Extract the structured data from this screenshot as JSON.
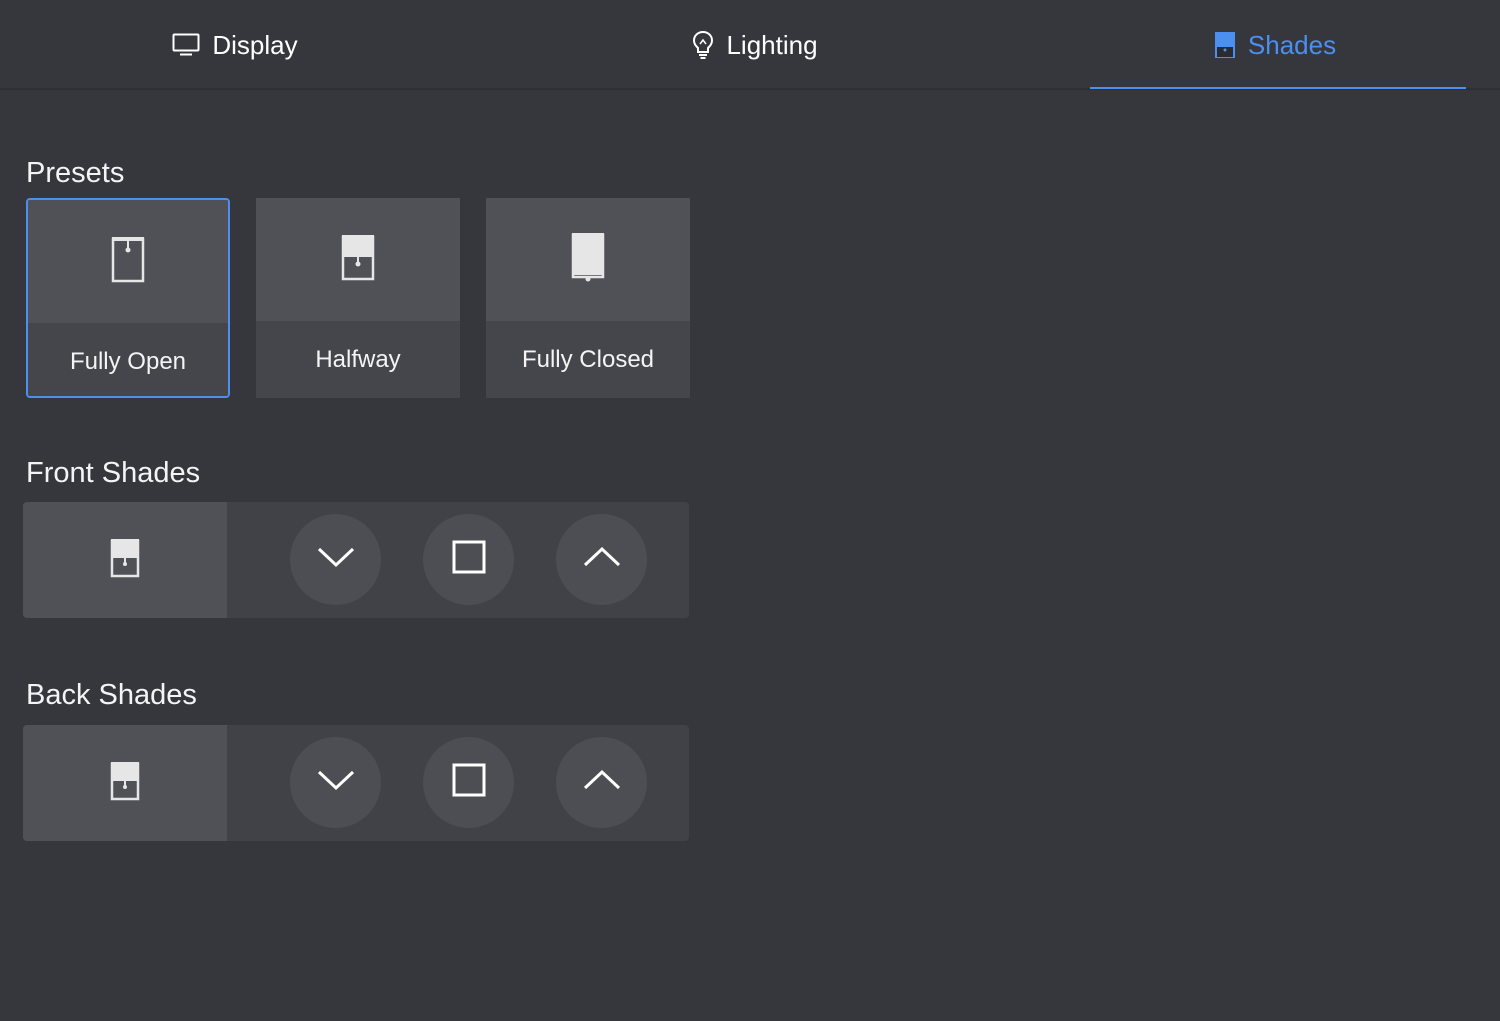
{
  "tabs": [
    {
      "label": "Display",
      "icon": "monitor-icon",
      "active": false
    },
    {
      "label": "Lighting",
      "icon": "lightbulb-icon",
      "active": false
    },
    {
      "label": "Shades",
      "icon": "shade-icon",
      "active": true
    }
  ],
  "colors": {
    "accent": "#4b8ff0",
    "background": "#36373d"
  },
  "presets": {
    "title": "Presets",
    "items": [
      {
        "label": "Fully Open",
        "icon": "shade-open-icon",
        "selected": true
      },
      {
        "label": "Halfway",
        "icon": "shade-halfway-icon",
        "selected": false
      },
      {
        "label": "Fully Closed",
        "icon": "shade-closed-icon",
        "selected": false
      }
    ]
  },
  "front_shades": {
    "title": "Front Shades",
    "status_icon": "shade-halfway-icon",
    "controls": [
      "chevron-down-icon",
      "stop-icon",
      "chevron-up-icon"
    ]
  },
  "back_shades": {
    "title": "Back Shades",
    "status_icon": "shade-halfway-icon",
    "controls": [
      "chevron-down-icon",
      "stop-icon",
      "chevron-up-icon"
    ]
  }
}
